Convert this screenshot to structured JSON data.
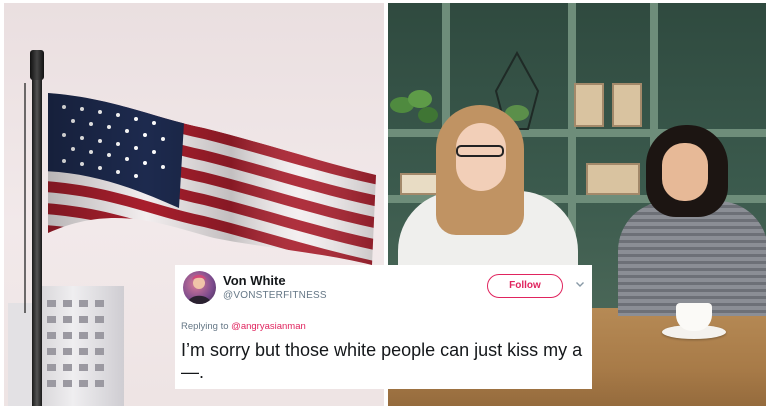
{
  "tweet": {
    "display_name": "Von White",
    "handle": "@VONSTERFITNESS",
    "follow_label": "Follow",
    "replying_prefix": "Replying to",
    "replying_to": "@angryasianman",
    "text": "I’m sorry but those white people can just kiss my a—.",
    "accent_color": "#e0245e"
  },
  "images": {
    "left": "american-flag-photo",
    "right": "cafe-women-photo"
  }
}
